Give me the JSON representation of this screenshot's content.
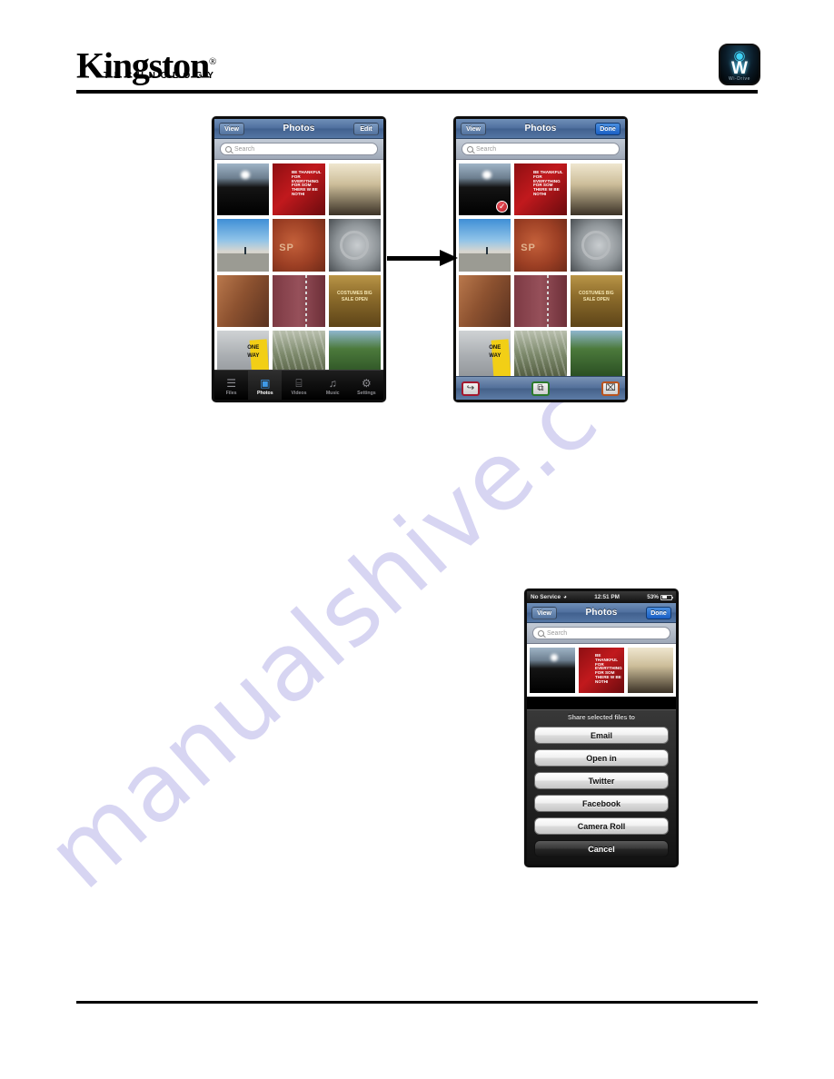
{
  "header": {
    "logo_word": "Kingston",
    "logo_registered": "®",
    "logo_sub": "TECHNOLOGY",
    "app_icon": {
      "name": "wi-drive-app-icon",
      "letter": "W",
      "sublabel": "Wi-Drive"
    }
  },
  "watermark": {
    "text": "manualshive.c"
  },
  "screen1": {
    "nav": {
      "left_button": "View",
      "title": "Photos",
      "right_button": "Edit"
    },
    "search": {
      "placeholder": "Search",
      "value": ""
    },
    "photos": [
      {
        "caption": "",
        "alt": "sunset-over-dark-hills"
      },
      {
        "caption": "BE THANKFUL FOR EVERYTHING FOR SOM THERE W BE NOTHI",
        "alt": "red-thankful-poster"
      },
      {
        "caption": "",
        "alt": "sepia-branches"
      },
      {
        "caption": "",
        "alt": "blue-sky-desert-road"
      },
      {
        "caption": "SP",
        "alt": "rusty-red-sign"
      },
      {
        "caption": "",
        "alt": "metal-gear-wheel"
      },
      {
        "caption": "",
        "alt": "rusted-wood-closeup"
      },
      {
        "caption": "",
        "alt": "chain-on-red-wall"
      },
      {
        "caption": "COSTUMES BIG SALE OPEN",
        "alt": "big-sale-open-signs"
      },
      {
        "caption": "ONE WAY",
        "alt": "brick-wall-one-way-sign"
      },
      {
        "caption": "",
        "alt": "rocky-cliff-trees"
      },
      {
        "caption": "",
        "alt": "green-tree"
      }
    ],
    "tabs": [
      {
        "label": "Files",
        "icon": "files-icon",
        "glyph": "὜E",
        "active": false
      },
      {
        "label": "Photos",
        "icon": "photos-icon",
        "glyph": "▣",
        "active": true
      },
      {
        "label": "Videos",
        "icon": "videos-icon",
        "glyph": "⌸",
        "active": false
      },
      {
        "label": "Music",
        "icon": "music-icon",
        "glyph": "♫",
        "active": false
      },
      {
        "label": "Settings",
        "icon": "settings-icon",
        "glyph": "⚙",
        "active": false
      }
    ]
  },
  "screen2": {
    "nav": {
      "left_button": "View",
      "title": "Photos",
      "right_button": "Done"
    },
    "search": {
      "placeholder": "Search",
      "value": ""
    },
    "selected_index": 0,
    "selection_check": "✓",
    "toolbar": [
      {
        "label": "Share",
        "icon": "share-icon",
        "glyph": "↪",
        "outline": "#a3182e"
      },
      {
        "label": "Copy",
        "icon": "copy-icon",
        "glyph": "❐",
        "outline": "#2c7a2c"
      },
      {
        "label": "Delete",
        "icon": "trash-icon",
        "glyph": "Ὕ1",
        "outline": "#b9531e"
      }
    ]
  },
  "screen3": {
    "status": {
      "carrier": "No Service",
      "wifi_icon": "wifi-icon",
      "time": "12:51 PM",
      "battery": "53%"
    },
    "nav": {
      "left_button": "View",
      "title": "Photos",
      "right_button": "Done"
    },
    "search": {
      "placeholder": "Search",
      "value": ""
    },
    "sheet": {
      "title": "Share selected files to",
      "buttons": [
        "Email",
        "Open in",
        "Twitter",
        "Facebook",
        "Camera Roll"
      ],
      "cancel": "Cancel"
    }
  },
  "arrow": {
    "direction": "right"
  },
  "colors": {
    "accent_blue": "#1a5fc4",
    "navbar_blue": "#4f6f9e",
    "selection_red": "#b81f29",
    "watermark": "#c9c6ee"
  }
}
